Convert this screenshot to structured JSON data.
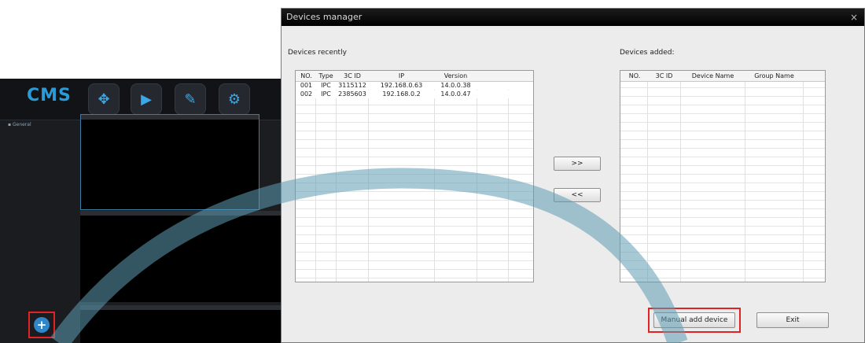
{
  "cms": {
    "logo": "CMS",
    "sidebar_item": "▪ General",
    "add_button_label": "+",
    "toolbar": [
      {
        "icon": "crosshair-icon",
        "glyph": "✥"
      },
      {
        "icon": "play-icon",
        "glyph": "▶"
      },
      {
        "icon": "edit-icon",
        "glyph": "✎"
      },
      {
        "icon": "settings-icon",
        "glyph": "⚙"
      }
    ]
  },
  "dialog": {
    "title": "Devices manager",
    "close_label": "×",
    "recent_label": "Devices recently",
    "added_label": "Devices added:",
    "recent_columns": [
      "NO.",
      "Type",
      "3C ID",
      "IP",
      "Version"
    ],
    "recent_rows": [
      [
        "001",
        "IPC",
        "3115112",
        "192.168.0.63",
        "14.0.0.38"
      ],
      [
        "002",
        "IPC",
        "2385603",
        "192.168.0.2",
        "14.0.0.47"
      ]
    ],
    "added_columns": [
      "NO.",
      "3C ID",
      "Device Name",
      "Group Name"
    ],
    "move_right_label": ">>",
    "move_left_label": "<<",
    "manual_add_label": "Manual add device",
    "exit_label": "Exit"
  },
  "colors": {
    "accent": "#2a9bd6",
    "highlight": "#e02424",
    "overlay_arc": "#5f9cb4"
  }
}
